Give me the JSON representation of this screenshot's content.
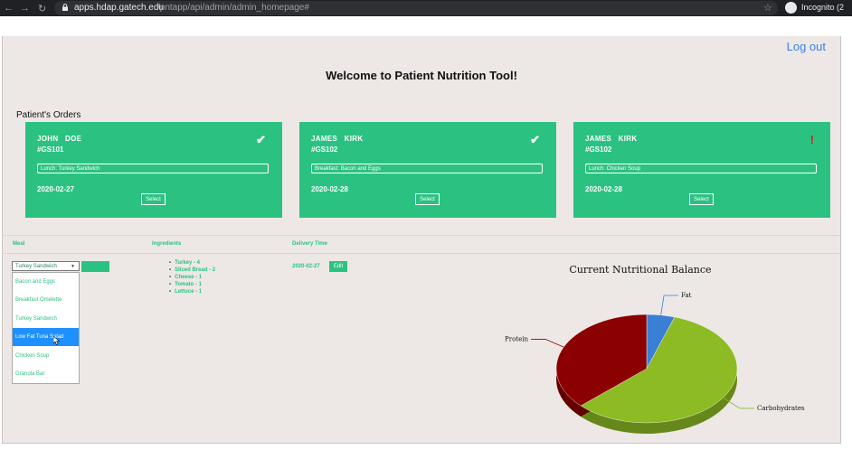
{
  "browser": {
    "url_host": "apps.hdap.gatech.edu",
    "url_path": "/pntapp/api/admin/admin_homepage#",
    "profile_label": "Incognito (2"
  },
  "page": {
    "logout_label": "Log out",
    "welcome": "Welcome to Patient Nutrition Tool!",
    "orders_title": "Patient's Orders"
  },
  "orders": [
    {
      "first": "JOHN",
      "last": "DOE",
      "id": "#GS101",
      "meal": "Lunch:  Turkey Sandwich",
      "date": "2020-02-27",
      "select_label": "Select",
      "status": "✔",
      "status_icon": "check-icon"
    },
    {
      "first": "JAMES",
      "last": "KIRK",
      "id": "#GS102",
      "meal": "Breakfast:  Bacon and Eggs",
      "date": "2020-02-28",
      "select_label": "Select",
      "status": "✔",
      "status_icon": "check-icon"
    },
    {
      "first": "JAMES",
      "last": "KIRK",
      "id": "#GS102",
      "meal": "Lunch:  Chicken Soup",
      "date": "2020-02-28",
      "select_label": "Select",
      "status": "!",
      "status_icon": "exclamation-icon"
    }
  ],
  "table": {
    "meal_header": "Meal",
    "ingredients_header": "Ingredients",
    "delivery_header": "Delivery Time",
    "selected_meal": "Turkey Sandwich",
    "meal_options": [
      "Bacon and Eggs",
      "Breakfast Omelette",
      "Turkey Sandwich",
      "Low Fat Tuna Salad",
      "Chicken Soup",
      "Granola Bar"
    ],
    "highlighted_option": "Low Fat Tuna Salad",
    "ingredients": [
      "Turkey - 4",
      "Sliced Bread - 2",
      "Cheese - 1",
      "Tomato - 1",
      "Lettuce - 1"
    ],
    "delivery_date": "2020-02-27",
    "edit_label": "Edit"
  },
  "chart_data": {
    "type": "pie",
    "title": "Current Nutritional Balance",
    "labels": [
      "Fat",
      "Carbohydrates",
      "Protein"
    ],
    "values": [
      5,
      58,
      37
    ],
    "colors": [
      "#3a7fd6",
      "#8dbb23",
      "#8b0000"
    ]
  },
  "colors": {
    "accent": "#2bc281",
    "link": "#3b82e6",
    "background": "#ede8e5",
    "alert": "#d2201a"
  }
}
